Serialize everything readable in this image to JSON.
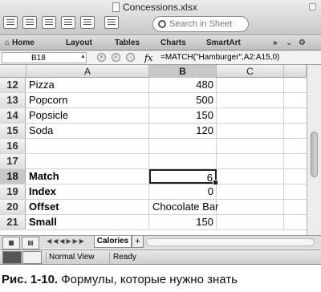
{
  "window": {
    "title": "Concessions.xlsx",
    "search_placeholder": "Search in Sheet"
  },
  "ribbon": {
    "tabs": [
      "Home",
      "Layout",
      "Tables",
      "Charts",
      "SmartArt"
    ],
    "overflow": "»"
  },
  "formula_bar": {
    "cell_ref": "B18",
    "fx": "fx",
    "formula": "=MATCH(\"Hamburger\",A2:A15,0)"
  },
  "sheet": {
    "columns": [
      "A",
      "B",
      "C"
    ],
    "selected_column": "B",
    "active_cell": "B18",
    "rows": [
      {
        "num": "12",
        "a": "Pizza",
        "b": "480",
        "bold": false
      },
      {
        "num": "13",
        "a": "Popcorn",
        "b": "500",
        "bold": false
      },
      {
        "num": "14",
        "a": "Popsicle",
        "b": "150",
        "bold": false
      },
      {
        "num": "15",
        "a": "Soda",
        "b": "120",
        "bold": false
      },
      {
        "num": "16",
        "a": "",
        "b": "",
        "bold": false
      },
      {
        "num": "17",
        "a": "",
        "b": "",
        "bold": false
      },
      {
        "num": "18",
        "a": "Match",
        "b": "6",
        "bold": true
      },
      {
        "num": "19",
        "a": "Index",
        "b": "0",
        "bold": true
      },
      {
        "num": "20",
        "a": "Offset",
        "b": "Chocolate Bar",
        "bold": true
      },
      {
        "num": "21",
        "a": "Small",
        "b": "150",
        "bold": true
      }
    ]
  },
  "sheet_tabs": {
    "active": "Calories",
    "add": "+"
  },
  "status": {
    "view_mode": "Normal View",
    "state": "Ready"
  },
  "caption": {
    "label": "Рис. 1-10.",
    "text": "Формулы, которые нужно знать"
  }
}
